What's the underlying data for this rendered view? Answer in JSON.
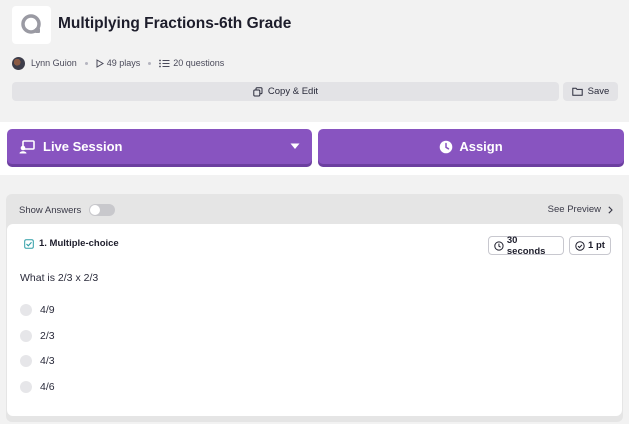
{
  "quiz": {
    "title": "Multiplying Fractions-6th Grade",
    "author": "Lynn Guion",
    "plays": "49 plays",
    "questions": "20 questions"
  },
  "toolbar": {
    "copy_edit_label": "Copy & Edit",
    "save_label": "Save"
  },
  "actions": {
    "live_session_label": "Live Session",
    "assign_label": "Assign"
  },
  "panel": {
    "show_answers_label": "Show Answers",
    "show_answers_on": false,
    "see_preview_label": "See Preview"
  },
  "question": {
    "type_label": "1. Multiple-choice",
    "time_label": "30 seconds",
    "points_label": "1 pt",
    "text": "What is 2/3 x 2/3",
    "options": [
      "4/9",
      "2/3",
      "4/3",
      "4/6"
    ]
  },
  "colors": {
    "accent": "#8854c0",
    "accent_shadow": "#6c3fa0",
    "background": "#f2f2f2",
    "card": "#ffffff",
    "checkbox_icon": "#2d9da6"
  },
  "icons": {
    "logo": "quizizz-logo-icon",
    "plays": "play-icon",
    "questions": "list-icon",
    "copy": "copy-icon",
    "save": "folder-icon",
    "live": "live-session-icon",
    "dropdown": "chevron-down-icon",
    "assign": "clock-icon",
    "preview": "chevron-right-icon",
    "qtype": "checkbox-icon",
    "time": "clock-icon",
    "points": "check-circle-icon"
  }
}
